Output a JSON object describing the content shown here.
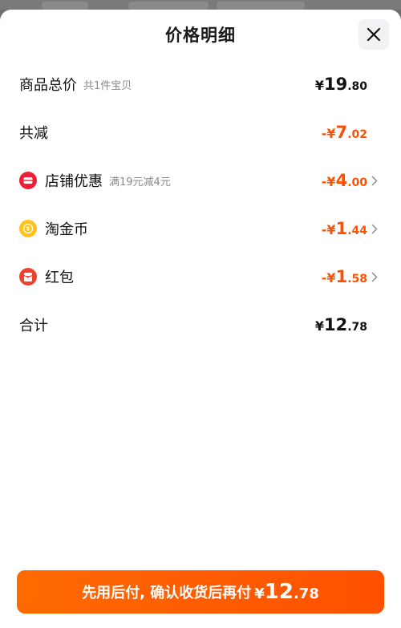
{
  "sheet": {
    "title": "价格明细",
    "close_icon": "close-icon"
  },
  "rows": {
    "subtotal": {
      "label": "商品总价",
      "note": "共1件宝贝",
      "sign": "¥",
      "int": "19",
      "dec": ".80"
    },
    "total_discount": {
      "label": "共减",
      "sign": "-¥",
      "int": "7",
      "dec": ".02"
    },
    "store_discount": {
      "icon": "store-coupon-icon",
      "label": "店铺优惠",
      "note": "满19元减4元",
      "sign": "-¥",
      "int": "4",
      "dec": ".00"
    },
    "taojinbi": {
      "icon": "gold-coin-icon",
      "label": "淘金币",
      "sign": "-¥",
      "int": "1",
      "dec": ".44"
    },
    "red_packet": {
      "icon": "red-packet-icon",
      "label": "红包",
      "sign": "-¥",
      "int": "1",
      "dec": ".58"
    },
    "total": {
      "label": "合计",
      "sign": "¥",
      "int": "12",
      "dec": ".78"
    }
  },
  "pay_button": {
    "text": "先用后付, 确认收货后再付",
    "sign": "¥",
    "int": "12",
    "dec": ".78"
  },
  "colors": {
    "accent": "#ff5000",
    "store_icon": "#ee1f36",
    "coin_icon": "#ffc21a",
    "red_packet_icon": "#f0412f"
  }
}
